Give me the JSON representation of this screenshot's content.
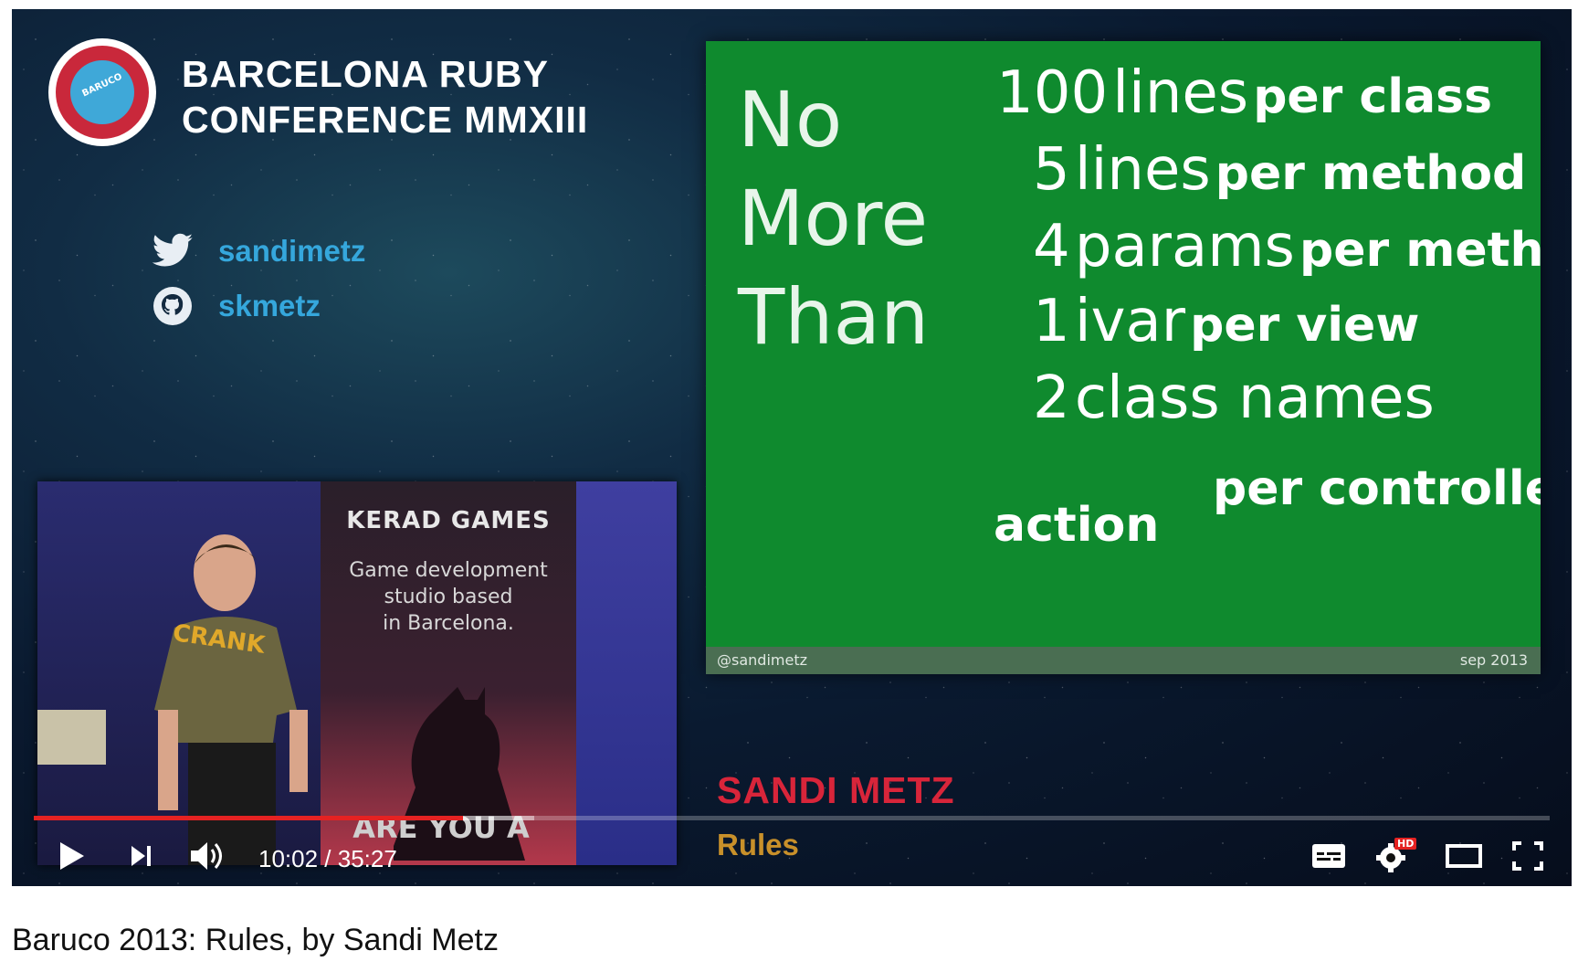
{
  "conference": {
    "logo_text": "BARUCO",
    "title_line1": "BARCELONA RUBY",
    "title_line2": "CONFERENCE MMXIII"
  },
  "social": [
    {
      "icon": "twitter-icon",
      "handle": "sandimetz"
    },
    {
      "icon": "github-icon",
      "handle": "skmetz"
    }
  ],
  "slide": {
    "heading": [
      "No",
      "More",
      "Than"
    ],
    "rules": [
      {
        "num": "100",
        "unit": "lines",
        "scope": "per class"
      },
      {
        "num": "5",
        "unit": "lines",
        "scope": "per method"
      },
      {
        "num": "4",
        "unit": "params",
        "scope": "per metho"
      },
      {
        "num": "1",
        "unit": "ivar",
        "scope": "per view"
      },
      {
        "num": "2",
        "unit": "class names",
        "scope": ""
      }
    ],
    "extra_scope": "per controller",
    "extra_action": "action",
    "footer_left": "@sandimetz",
    "footer_right": "sep 2013",
    "bg_color": "#0f8a2e"
  },
  "inset": {
    "banner_title": "KERAD GAMES",
    "banner_desc": [
      "Game development",
      "studio based",
      "in Barcelona."
    ],
    "banner_bottom": "ARE YOU A",
    "shirt_text": "CRANK"
  },
  "speaker": {
    "name": "SANDI METZ",
    "talk": "Rules"
  },
  "player": {
    "current_time": "10:02",
    "duration": "35:27",
    "time_display": "10:02 / 35:27",
    "played_fraction": 0.283,
    "buffered_fraction": 0.33,
    "hd_badge": "HD",
    "progress_color": "#e52222"
  },
  "video_title": "Baruco 2013: Rules, by Sandi Metz"
}
